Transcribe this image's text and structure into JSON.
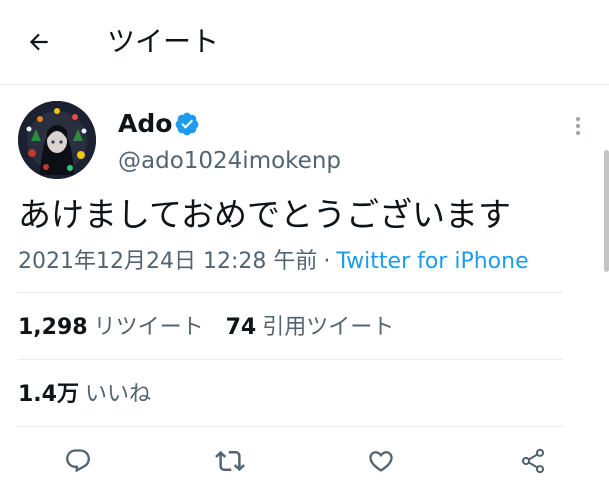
{
  "header": {
    "title": "ツイート"
  },
  "tweet": {
    "author_name": "Ado",
    "handle": "@ado1024imokenp",
    "text": "あけましておめでとうございます",
    "timestamp": "2021年12月24日 12:28 午前",
    "separator": "·",
    "source": "Twitter for iPhone"
  },
  "stats": {
    "retweets_count": "1,298",
    "retweets_label": "リツイート",
    "quotes_count": "74",
    "quotes_label": "引用ツイート",
    "likes_count": "1.4万",
    "likes_label": "いいね"
  },
  "icons": {
    "back": "arrow-left-icon",
    "verified": "verified-badge-icon",
    "more": "more-vertical-icon",
    "reply": "reply-icon",
    "retweet": "retweet-icon",
    "like": "heart-icon",
    "share": "share-icon"
  },
  "colors": {
    "accent": "#1d9bf0",
    "text": "#0f1419",
    "secondary": "#536471",
    "divider": "#e6ecf0"
  }
}
